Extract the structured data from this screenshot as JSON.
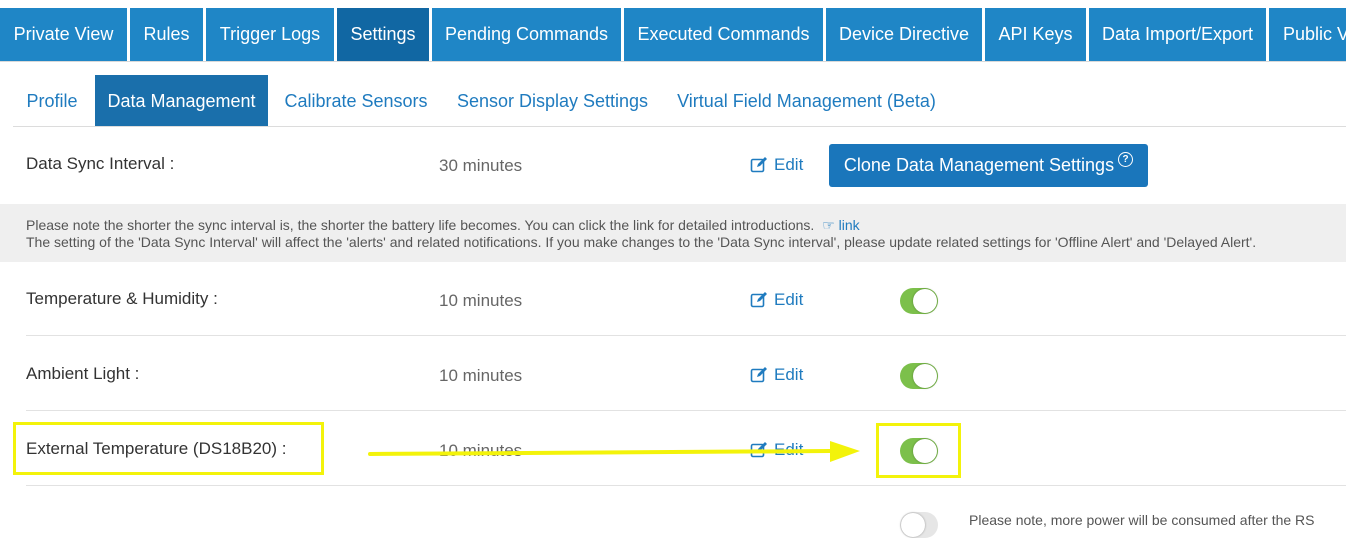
{
  "top_tabs": [
    "Private View",
    "Rules",
    "Trigger Logs",
    "Settings",
    "Pending Commands",
    "Executed Commands",
    "Device Directive",
    "API Keys",
    "Data Import/Export",
    "Public View"
  ],
  "active_top_tab": "Settings",
  "sub_tabs": [
    "Profile",
    "Data Management",
    "Calibrate Sensors",
    "Sensor Display Settings",
    "Virtual Field Management (Beta)"
  ],
  "active_sub_tab": "Data Management",
  "sync": {
    "label": "Data Sync Interval :",
    "value": "30 minutes",
    "edit": "Edit",
    "clone_button": "Clone Data Management Settings"
  },
  "note": {
    "line1": "Please note the shorter the sync interval is, the shorter the battery life becomes. You can click the link for detailed introductions.",
    "link": "link",
    "line2": "The setting of the 'Data Sync Interval' will affect the 'alerts' and related notifications. If you make changes to the 'Data Sync interval', please update related settings for 'Offline Alert' and 'Delayed Alert'."
  },
  "rows": [
    {
      "label": "Temperature & Humidity :",
      "value": "10 minutes",
      "edit": "Edit",
      "enabled": true
    },
    {
      "label": "Ambient Light :",
      "value": "10 minutes",
      "edit": "Edit",
      "enabled": true
    },
    {
      "label": "External Temperature (DS18B20) :",
      "value": "10 minutes",
      "edit": "Edit",
      "enabled": true
    }
  ],
  "bottom_note": "Please note, more power will be consumed after the RS",
  "colors": {
    "tab_blue": "#1f86c6",
    "toggle_on": "#7cc04b",
    "highlight": "#f3f30a"
  }
}
